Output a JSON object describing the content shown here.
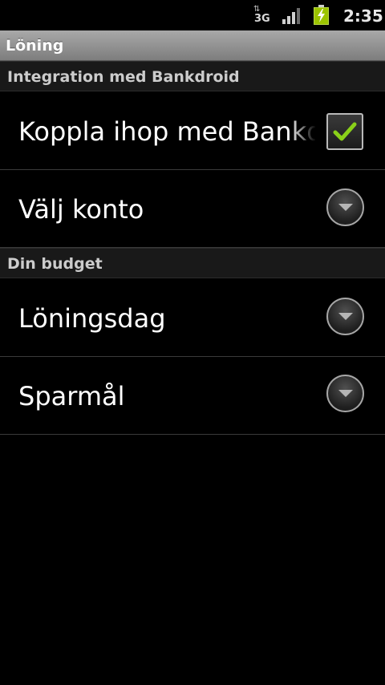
{
  "status_bar": {
    "network_type": "3G",
    "network_arrows": "⇅",
    "signal_level": 0.75,
    "battery_state": "charging",
    "clock": "2:35",
    "icons": [
      "data-3g-icon",
      "signal-icon",
      "battery-charging-icon"
    ]
  },
  "title_bar": {
    "title": "Löning"
  },
  "sections": [
    {
      "header": "Integration med Bankdroid",
      "items": [
        {
          "title": "Koppla ihop med Bankdroid",
          "widget": "checkbox",
          "checked": true
        },
        {
          "title": "Välj konto",
          "widget": "dropdown"
        }
      ]
    },
    {
      "header": "Din budget",
      "items": [
        {
          "title": "Löningsdag",
          "widget": "dropdown"
        },
        {
          "title": "Sparmål",
          "widget": "dropdown"
        }
      ]
    }
  ],
  "colors": {
    "background": "#000000",
    "title_bar": "#8f8f8f",
    "category_bg": "#191919",
    "checkmark": "#8ad119",
    "battery": "#9cc400"
  }
}
